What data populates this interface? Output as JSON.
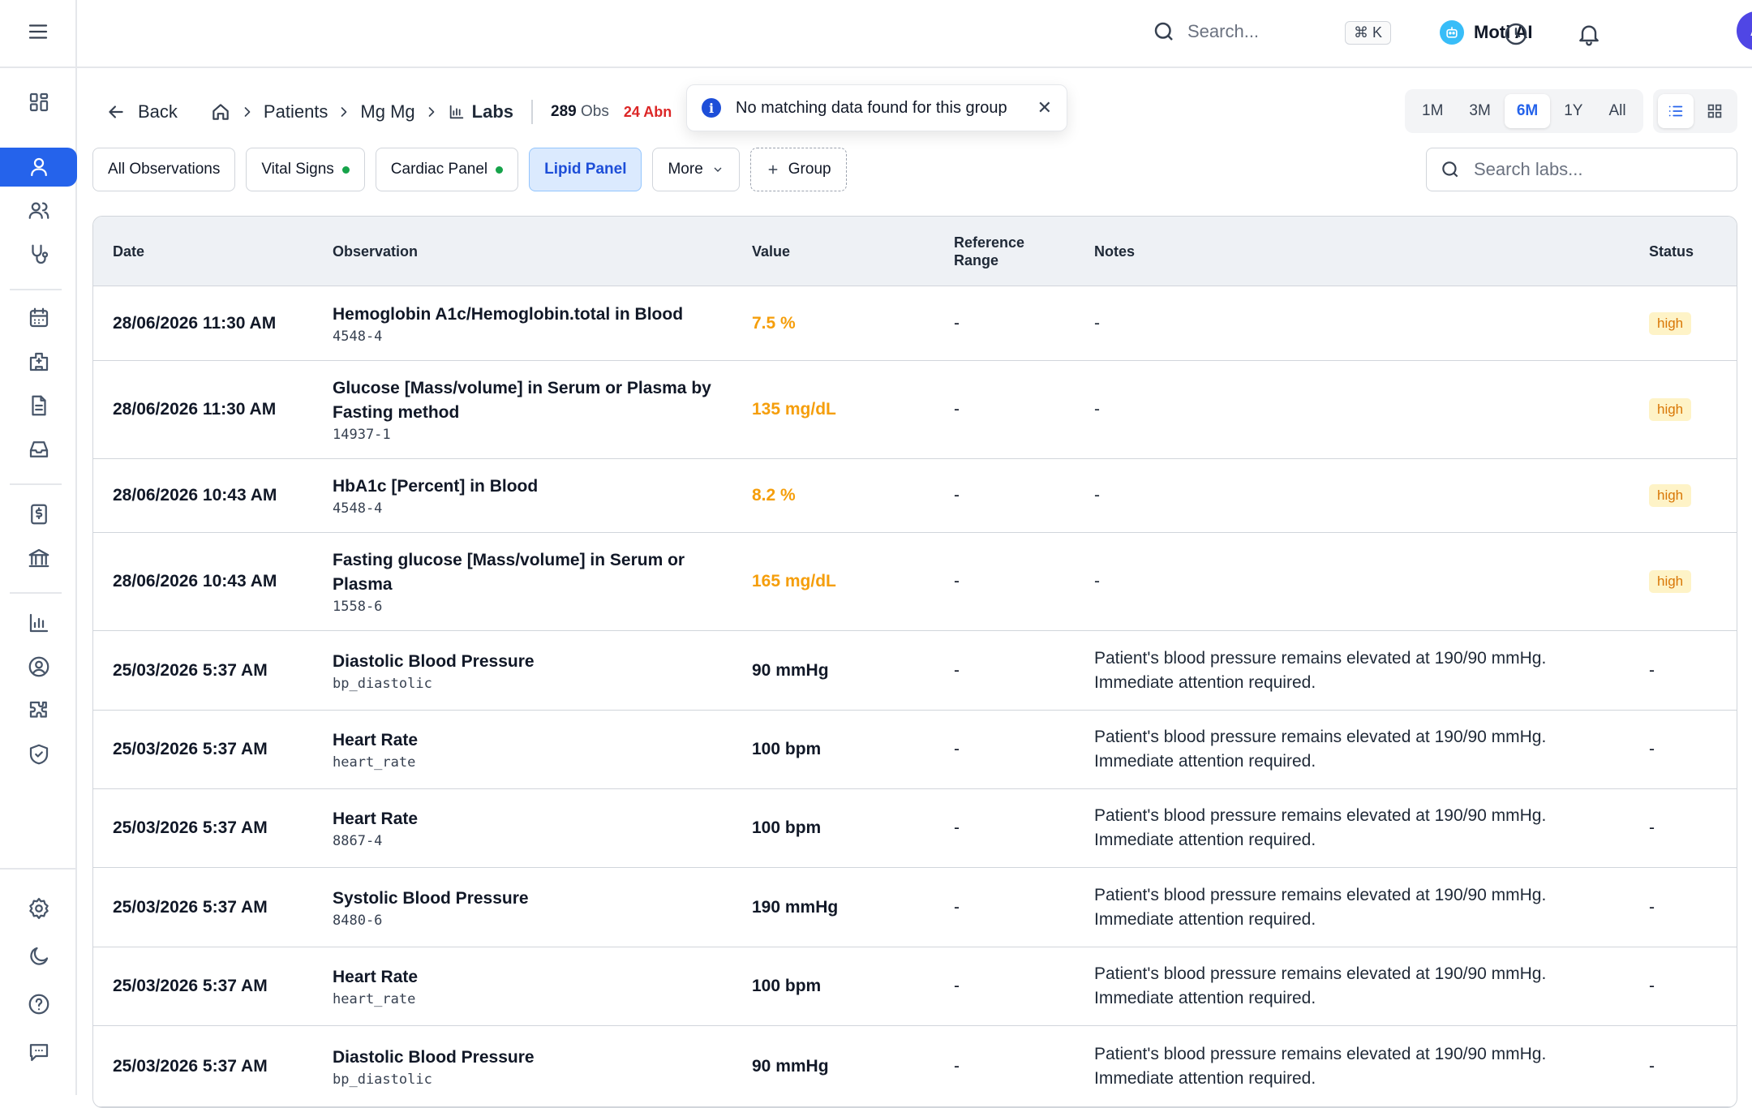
{
  "topbar": {
    "search_placeholder": "Search...",
    "shortcut": "⌘ K",
    "ai_label": "Moti AI",
    "avatar_initial": "A"
  },
  "breadcrumb": {
    "back": "Back",
    "patients": "Patients",
    "patient_name": "Mg Mg",
    "current": "Labs",
    "obs_count": "289",
    "obs_suffix": "Obs",
    "abnormal_partial": "24 Abn"
  },
  "toast": {
    "message": "No matching data found for this group"
  },
  "time_ranges": [
    "1M",
    "3M",
    "6M",
    "1Y",
    "All"
  ],
  "active_range": "6M",
  "groups": {
    "all": "All Observations",
    "vitals": "Vital Signs",
    "cardiac": "Cardiac Panel",
    "lipid": "Lipid Panel",
    "more": "More",
    "add": "Group"
  },
  "lab_search_placeholder": "Search labs...",
  "table": {
    "headers": {
      "date": "Date",
      "observation": "Observation",
      "value": "Value",
      "reference_range": "Reference Range",
      "notes": "Notes",
      "status": "Status"
    },
    "rows": [
      {
        "date": "28/06/2026 11:30 AM",
        "name": "Hemoglobin A1c/Hemoglobin.total in Blood",
        "code": "4548-4",
        "value": "7.5 %",
        "ref": "-",
        "notes": "-",
        "status": "high"
      },
      {
        "date": "28/06/2026 11:30 AM",
        "name": "Glucose [Mass/volume] in Serum or Plasma by Fasting method",
        "code": "14937-1",
        "value": "135 mg/dL",
        "ref": "-",
        "notes": "-",
        "status": "high"
      },
      {
        "date": "28/06/2026 10:43 AM",
        "name": "HbA1c [Percent] in Blood",
        "code": "4548-4",
        "value": "8.2 %",
        "ref": "-",
        "notes": "-",
        "status": "high"
      },
      {
        "date": "28/06/2026 10:43 AM",
        "name": "Fasting glucose [Mass/volume] in Serum or Plasma",
        "code": "1558-6",
        "value": "165 mg/dL",
        "ref": "-",
        "notes": "-",
        "status": "high"
      },
      {
        "date": "25/03/2026 5:37 AM",
        "name": "Diastolic Blood Pressure",
        "code": "bp_diastolic",
        "value": "90 mmHg",
        "ref": "-",
        "notes": "Patient's blood pressure remains elevated at 190/90 mmHg. Immediate attention required.",
        "status": "-"
      },
      {
        "date": "25/03/2026 5:37 AM",
        "name": "Heart Rate",
        "code": "heart_rate",
        "value": "100 bpm",
        "ref": "-",
        "notes": "Patient's blood pressure remains elevated at 190/90 mmHg. Immediate attention required.",
        "status": "-"
      },
      {
        "date": "25/03/2026 5:37 AM",
        "name": "Heart Rate",
        "code": "8867-4",
        "value": "100 bpm",
        "ref": "-",
        "notes": "Patient's blood pressure remains elevated at 190/90 mmHg. Immediate attention required.",
        "status": "-"
      },
      {
        "date": "25/03/2026 5:37 AM",
        "name": "Systolic Blood Pressure",
        "code": "8480-6",
        "value": "190 mmHg",
        "ref": "-",
        "notes": "Patient's blood pressure remains elevated at 190/90 mmHg. Immediate attention required.",
        "status": "-"
      },
      {
        "date": "25/03/2026 5:37 AM",
        "name": "Heart Rate",
        "code": "heart_rate",
        "value": "100 bpm",
        "ref": "-",
        "notes": "Patient's blood pressure remains elevated at 190/90 mmHg. Immediate attention required.",
        "status": "-"
      },
      {
        "date": "25/03/2026 5:37 AM",
        "name": "Diastolic Blood Pressure",
        "code": "bp_diastolic",
        "value": "90 mmHg",
        "ref": "-",
        "notes": "Patient's blood pressure remains elevated at 190/90 mmHg. Immediate attention required.",
        "status": "-"
      }
    ]
  },
  "colors": {
    "accent": "#2563eb",
    "high_value": "#f59e0b",
    "abnormal": "#dc2626",
    "online": "#22c55e"
  }
}
